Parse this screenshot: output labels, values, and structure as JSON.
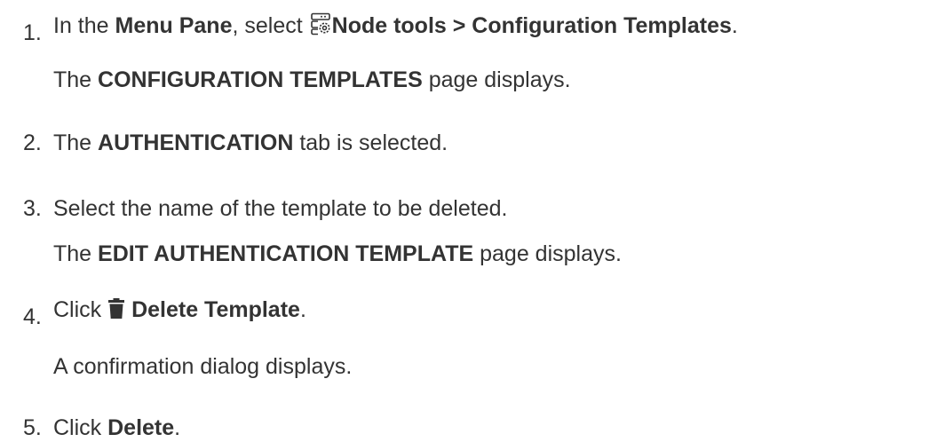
{
  "steps": [
    {
      "number": "1.",
      "pre": "In the ",
      "menu_pane": "Menu Pane",
      "mid": ", select ",
      "icon": "node-tools-icon",
      "path": "Node tools > Configuration Templates",
      "end": ".",
      "sub": {
        "pre": "The ",
        "bold": "CONFIGURATION TEMPLATES",
        "post": " page displays."
      }
    },
    {
      "number": "2.",
      "pre": "The ",
      "bold": "AUTHENTICATION",
      "post": " tab is selected."
    },
    {
      "number": "3.",
      "text": "Select the name of the template to be deleted.",
      "sub": {
        "pre": "The ",
        "bold": "EDIT AUTHENTICATION TEMPLATE",
        "post": " page displays."
      }
    },
    {
      "number": "4.",
      "pre": "Click ",
      "icon": "trash-icon",
      "bold": "Delete Template",
      "end": ".",
      "sub": {
        "text": "A confirmation dialog displays."
      }
    },
    {
      "number": "5.",
      "pre": "Click ",
      "bold": "Delete",
      "end": "."
    }
  ],
  "colors": {
    "text": "#333333"
  }
}
